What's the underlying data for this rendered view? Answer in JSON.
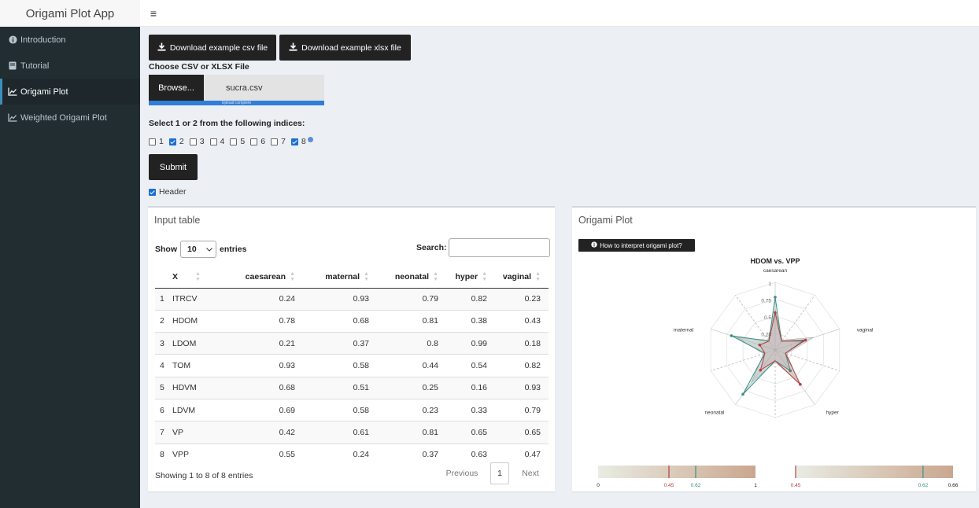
{
  "app": {
    "title": "Origami Plot App",
    "menu_toggle": "≡"
  },
  "sidebar": {
    "items": [
      {
        "label": "Introduction",
        "icon": "info-circle-icon"
      },
      {
        "label": "Tutorial",
        "icon": "book-icon"
      },
      {
        "label": "Origami Plot",
        "icon": "line-chart-icon",
        "active": true
      },
      {
        "label": "Weighted Origami Plot",
        "icon": "line-chart-icon"
      }
    ]
  },
  "controls": {
    "download_csv": "Download example csv file",
    "download_xlsx": "Download example xlsx file",
    "file_label": "Choose CSV or XLSX File",
    "browse": "Browse...",
    "file_name": "sucra.csv",
    "upload_status": "Upload complete",
    "indices_label": "Select 1 or 2 from the following indices:",
    "indices": [
      {
        "label": "1",
        "checked": false
      },
      {
        "label": "2",
        "checked": true
      },
      {
        "label": "3",
        "checked": false
      },
      {
        "label": "4",
        "checked": false
      },
      {
        "label": "5",
        "checked": false
      },
      {
        "label": "6",
        "checked": false
      },
      {
        "label": "7",
        "checked": false
      },
      {
        "label": "8",
        "checked": true
      }
    ],
    "submit": "Submit",
    "header_label": "Header",
    "header_checked": true
  },
  "table_panel": {
    "title": "Input table",
    "show": "Show",
    "entries_value": "10",
    "entries": "entries",
    "search": "Search:",
    "columns": [
      "",
      "X",
      "caesarean",
      "maternal",
      "neonatal",
      "hyper",
      "vaginal"
    ],
    "rows": [
      [
        "1",
        "ITRCV",
        "0.24",
        "0.93",
        "0.79",
        "0.82",
        "0.23"
      ],
      [
        "2",
        "HDOM",
        "0.78",
        "0.68",
        "0.81",
        "0.38",
        "0.43"
      ],
      [
        "3",
        "LDOM",
        "0.21",
        "0.37",
        "0.8",
        "0.99",
        "0.18"
      ],
      [
        "4",
        "TOM",
        "0.93",
        "0.58",
        "0.44",
        "0.54",
        "0.82"
      ],
      [
        "5",
        "HDVM",
        "0.68",
        "0.51",
        "0.25",
        "0.16",
        "0.93"
      ],
      [
        "6",
        "LDVM",
        "0.69",
        "0.58",
        "0.23",
        "0.33",
        "0.79"
      ],
      [
        "7",
        "VP",
        "0.42",
        "0.61",
        "0.81",
        "0.65",
        "0.65"
      ],
      [
        "8",
        "VPP",
        "0.55",
        "0.24",
        "0.37",
        "0.63",
        "0.47"
      ]
    ],
    "info": "Showing 1 to 8 of 8 entries",
    "previous": "Previous",
    "page": "1",
    "next": "Next"
  },
  "plot_panel": {
    "title": "Origami Plot",
    "interpret_button": "How to interpret origami plot?",
    "chart_data": {
      "type": "radar",
      "title": "HDOM vs. VPP",
      "axes": [
        "caesarean",
        "vaginal",
        "hyper",
        "neonatal",
        "maternal"
      ],
      "rings": [
        0.25,
        0.5,
        0.75,
        1
      ],
      "ring_labels": [
        "0.25",
        "0.5",
        "0.75",
        "1"
      ],
      "series": [
        {
          "name": "HDOM",
          "color": "#3a8f85",
          "values": [
            0.78,
            0.43,
            0.38,
            0.81,
            0.68
          ]
        },
        {
          "name": "VPP",
          "color": "#b3403f",
          "values": [
            0.55,
            0.47,
            0.63,
            0.37,
            0.24
          ]
        }
      ],
      "bars": [
        {
          "min": 0,
          "max": 1,
          "labels": [
            "0",
            "0.45",
            "0.62",
            "1"
          ],
          "markers": [
            {
              "value": 0.45,
              "color": "#b3403f"
            },
            {
              "value": 0.62,
              "color": "#3a8f85"
            }
          ]
        },
        {
          "min": 0.45,
          "max": 0.66,
          "labels": [
            "0.45",
            "0.62",
            "0.66"
          ],
          "markers": [
            {
              "value": 0.45,
              "color": "#b3403f"
            },
            {
              "value": 0.62,
              "color": "#3a8f85"
            }
          ]
        }
      ]
    }
  }
}
